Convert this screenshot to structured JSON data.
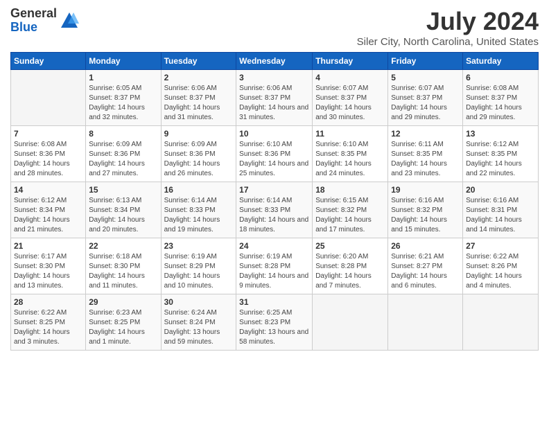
{
  "logo": {
    "general": "General",
    "blue": "Blue"
  },
  "title": "July 2024",
  "subtitle": "Siler City, North Carolina, United States",
  "days_of_week": [
    "Sunday",
    "Monday",
    "Tuesday",
    "Wednesday",
    "Thursday",
    "Friday",
    "Saturday"
  ],
  "weeks": [
    [
      {
        "day": "",
        "sunrise": "",
        "sunset": "",
        "daylight": ""
      },
      {
        "day": "1",
        "sunrise": "Sunrise: 6:05 AM",
        "sunset": "Sunset: 8:37 PM",
        "daylight": "Daylight: 14 hours and 32 minutes."
      },
      {
        "day": "2",
        "sunrise": "Sunrise: 6:06 AM",
        "sunset": "Sunset: 8:37 PM",
        "daylight": "Daylight: 14 hours and 31 minutes."
      },
      {
        "day": "3",
        "sunrise": "Sunrise: 6:06 AM",
        "sunset": "Sunset: 8:37 PM",
        "daylight": "Daylight: 14 hours and 31 minutes."
      },
      {
        "day": "4",
        "sunrise": "Sunrise: 6:07 AM",
        "sunset": "Sunset: 8:37 PM",
        "daylight": "Daylight: 14 hours and 30 minutes."
      },
      {
        "day": "5",
        "sunrise": "Sunrise: 6:07 AM",
        "sunset": "Sunset: 8:37 PM",
        "daylight": "Daylight: 14 hours and 29 minutes."
      },
      {
        "day": "6",
        "sunrise": "Sunrise: 6:08 AM",
        "sunset": "Sunset: 8:37 PM",
        "daylight": "Daylight: 14 hours and 29 minutes."
      }
    ],
    [
      {
        "day": "7",
        "sunrise": "Sunrise: 6:08 AM",
        "sunset": "Sunset: 8:36 PM",
        "daylight": "Daylight: 14 hours and 28 minutes."
      },
      {
        "day": "8",
        "sunrise": "Sunrise: 6:09 AM",
        "sunset": "Sunset: 8:36 PM",
        "daylight": "Daylight: 14 hours and 27 minutes."
      },
      {
        "day": "9",
        "sunrise": "Sunrise: 6:09 AM",
        "sunset": "Sunset: 8:36 PM",
        "daylight": "Daylight: 14 hours and 26 minutes."
      },
      {
        "day": "10",
        "sunrise": "Sunrise: 6:10 AM",
        "sunset": "Sunset: 8:36 PM",
        "daylight": "Daylight: 14 hours and 25 minutes."
      },
      {
        "day": "11",
        "sunrise": "Sunrise: 6:10 AM",
        "sunset": "Sunset: 8:35 PM",
        "daylight": "Daylight: 14 hours and 24 minutes."
      },
      {
        "day": "12",
        "sunrise": "Sunrise: 6:11 AM",
        "sunset": "Sunset: 8:35 PM",
        "daylight": "Daylight: 14 hours and 23 minutes."
      },
      {
        "day": "13",
        "sunrise": "Sunrise: 6:12 AM",
        "sunset": "Sunset: 8:35 PM",
        "daylight": "Daylight: 14 hours and 22 minutes."
      }
    ],
    [
      {
        "day": "14",
        "sunrise": "Sunrise: 6:12 AM",
        "sunset": "Sunset: 8:34 PM",
        "daylight": "Daylight: 14 hours and 21 minutes."
      },
      {
        "day": "15",
        "sunrise": "Sunrise: 6:13 AM",
        "sunset": "Sunset: 8:34 PM",
        "daylight": "Daylight: 14 hours and 20 minutes."
      },
      {
        "day": "16",
        "sunrise": "Sunrise: 6:14 AM",
        "sunset": "Sunset: 8:33 PM",
        "daylight": "Daylight: 14 hours and 19 minutes."
      },
      {
        "day": "17",
        "sunrise": "Sunrise: 6:14 AM",
        "sunset": "Sunset: 8:33 PM",
        "daylight": "Daylight: 14 hours and 18 minutes."
      },
      {
        "day": "18",
        "sunrise": "Sunrise: 6:15 AM",
        "sunset": "Sunset: 8:32 PM",
        "daylight": "Daylight: 14 hours and 17 minutes."
      },
      {
        "day": "19",
        "sunrise": "Sunrise: 6:16 AM",
        "sunset": "Sunset: 8:32 PM",
        "daylight": "Daylight: 14 hours and 15 minutes."
      },
      {
        "day": "20",
        "sunrise": "Sunrise: 6:16 AM",
        "sunset": "Sunset: 8:31 PM",
        "daylight": "Daylight: 14 hours and 14 minutes."
      }
    ],
    [
      {
        "day": "21",
        "sunrise": "Sunrise: 6:17 AM",
        "sunset": "Sunset: 8:30 PM",
        "daylight": "Daylight: 14 hours and 13 minutes."
      },
      {
        "day": "22",
        "sunrise": "Sunrise: 6:18 AM",
        "sunset": "Sunset: 8:30 PM",
        "daylight": "Daylight: 14 hours and 11 minutes."
      },
      {
        "day": "23",
        "sunrise": "Sunrise: 6:19 AM",
        "sunset": "Sunset: 8:29 PM",
        "daylight": "Daylight: 14 hours and 10 minutes."
      },
      {
        "day": "24",
        "sunrise": "Sunrise: 6:19 AM",
        "sunset": "Sunset: 8:28 PM",
        "daylight": "Daylight: 14 hours and 9 minutes."
      },
      {
        "day": "25",
        "sunrise": "Sunrise: 6:20 AM",
        "sunset": "Sunset: 8:28 PM",
        "daylight": "Daylight: 14 hours and 7 minutes."
      },
      {
        "day": "26",
        "sunrise": "Sunrise: 6:21 AM",
        "sunset": "Sunset: 8:27 PM",
        "daylight": "Daylight: 14 hours and 6 minutes."
      },
      {
        "day": "27",
        "sunrise": "Sunrise: 6:22 AM",
        "sunset": "Sunset: 8:26 PM",
        "daylight": "Daylight: 14 hours and 4 minutes."
      }
    ],
    [
      {
        "day": "28",
        "sunrise": "Sunrise: 6:22 AM",
        "sunset": "Sunset: 8:25 PM",
        "daylight": "Daylight: 14 hours and 3 minutes."
      },
      {
        "day": "29",
        "sunrise": "Sunrise: 6:23 AM",
        "sunset": "Sunset: 8:25 PM",
        "daylight": "Daylight: 14 hours and 1 minute."
      },
      {
        "day": "30",
        "sunrise": "Sunrise: 6:24 AM",
        "sunset": "Sunset: 8:24 PM",
        "daylight": "Daylight: 13 hours and 59 minutes."
      },
      {
        "day": "31",
        "sunrise": "Sunrise: 6:25 AM",
        "sunset": "Sunset: 8:23 PM",
        "daylight": "Daylight: 13 hours and 58 minutes."
      },
      {
        "day": "",
        "sunrise": "",
        "sunset": "",
        "daylight": ""
      },
      {
        "day": "",
        "sunrise": "",
        "sunset": "",
        "daylight": ""
      },
      {
        "day": "",
        "sunrise": "",
        "sunset": "",
        "daylight": ""
      }
    ]
  ]
}
